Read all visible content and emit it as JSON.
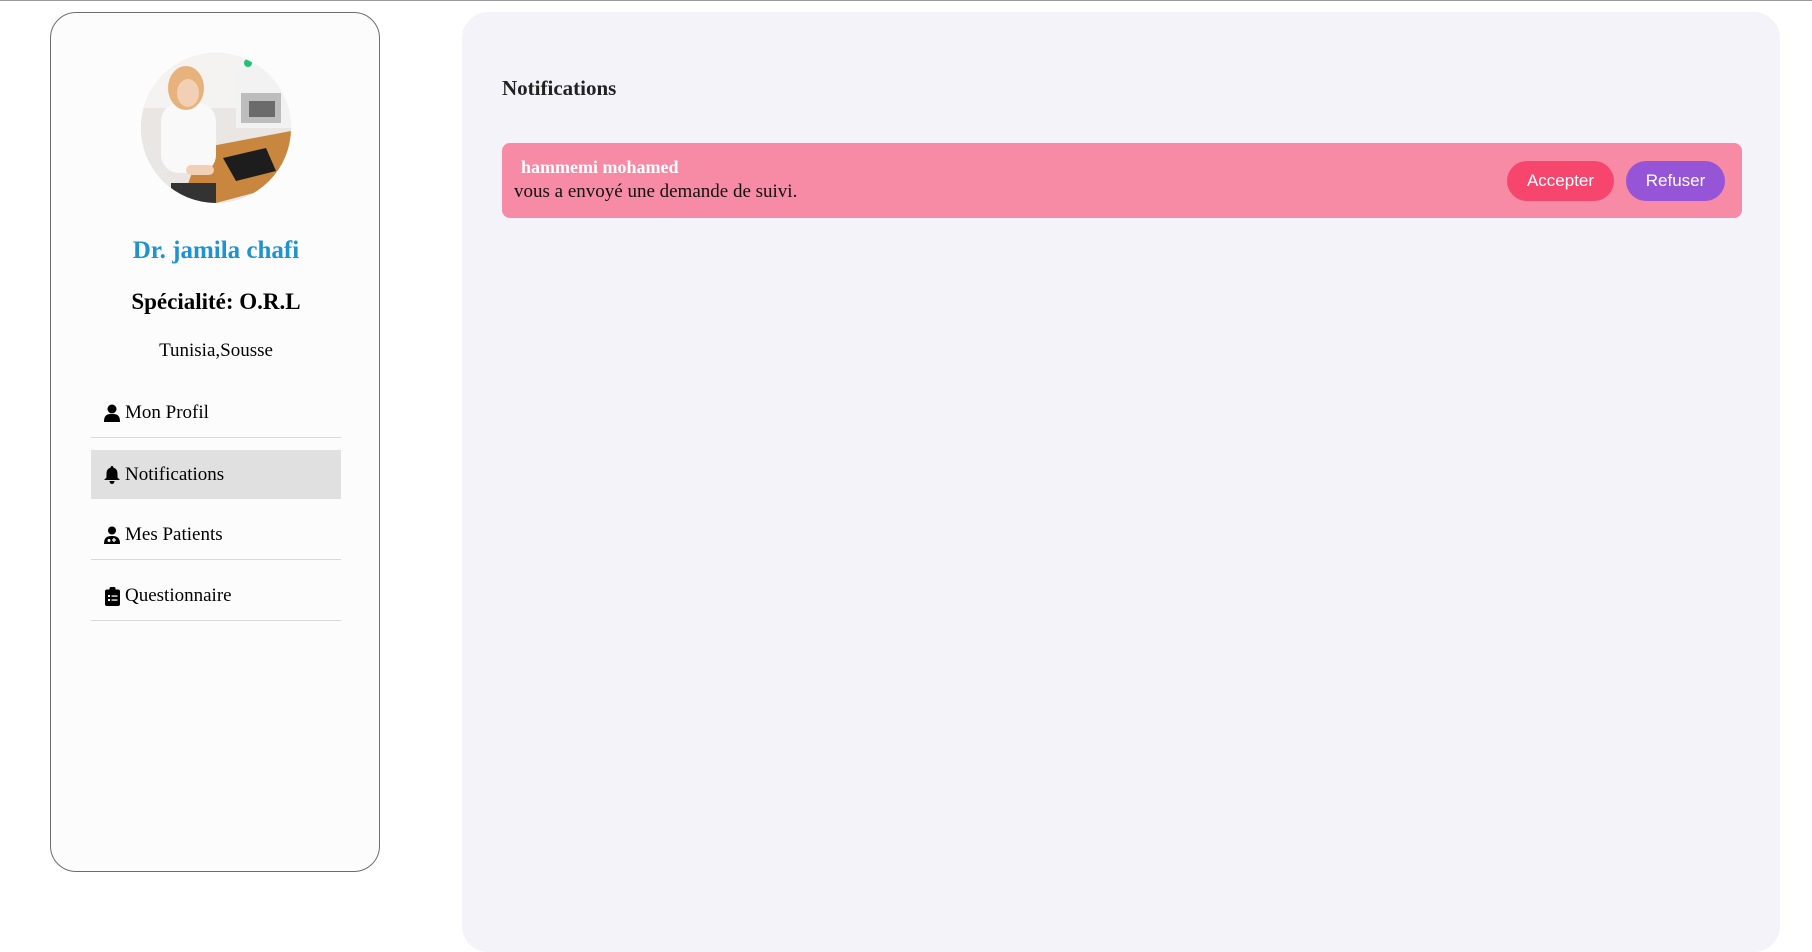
{
  "profile": {
    "avatar_alt": "doctor-photo",
    "name": "Dr. jamila chafi",
    "specialty": "Spécialité: O.R.L",
    "location": "Tunisia,Sousse"
  },
  "menu": {
    "items": [
      {
        "label": "Mon Profil",
        "icon": "user-icon",
        "active": false
      },
      {
        "label": "Notifications",
        "icon": "bell-icon",
        "active": true
      },
      {
        "label": "Mes Patients",
        "icon": "user-doctor-icon",
        "active": false
      },
      {
        "label": "Questionnaire",
        "icon": "clipboard-list-icon",
        "active": false
      }
    ]
  },
  "main": {
    "title": "Notifications",
    "notifications": [
      {
        "sender": "hammemi mohamed",
        "message": "vous a envoyé une demande de suivi.",
        "accept_label": "Accepter",
        "refuse_label": "Refuser"
      }
    ]
  },
  "colors": {
    "doctor_name": "#1e93cf",
    "notification_bg": "#f78aa4",
    "accept_button": "#f7466d",
    "refuse_button": "#9555d6",
    "main_bg": "#f4f3f9",
    "active_menu_bg": "#e1e0e0"
  }
}
